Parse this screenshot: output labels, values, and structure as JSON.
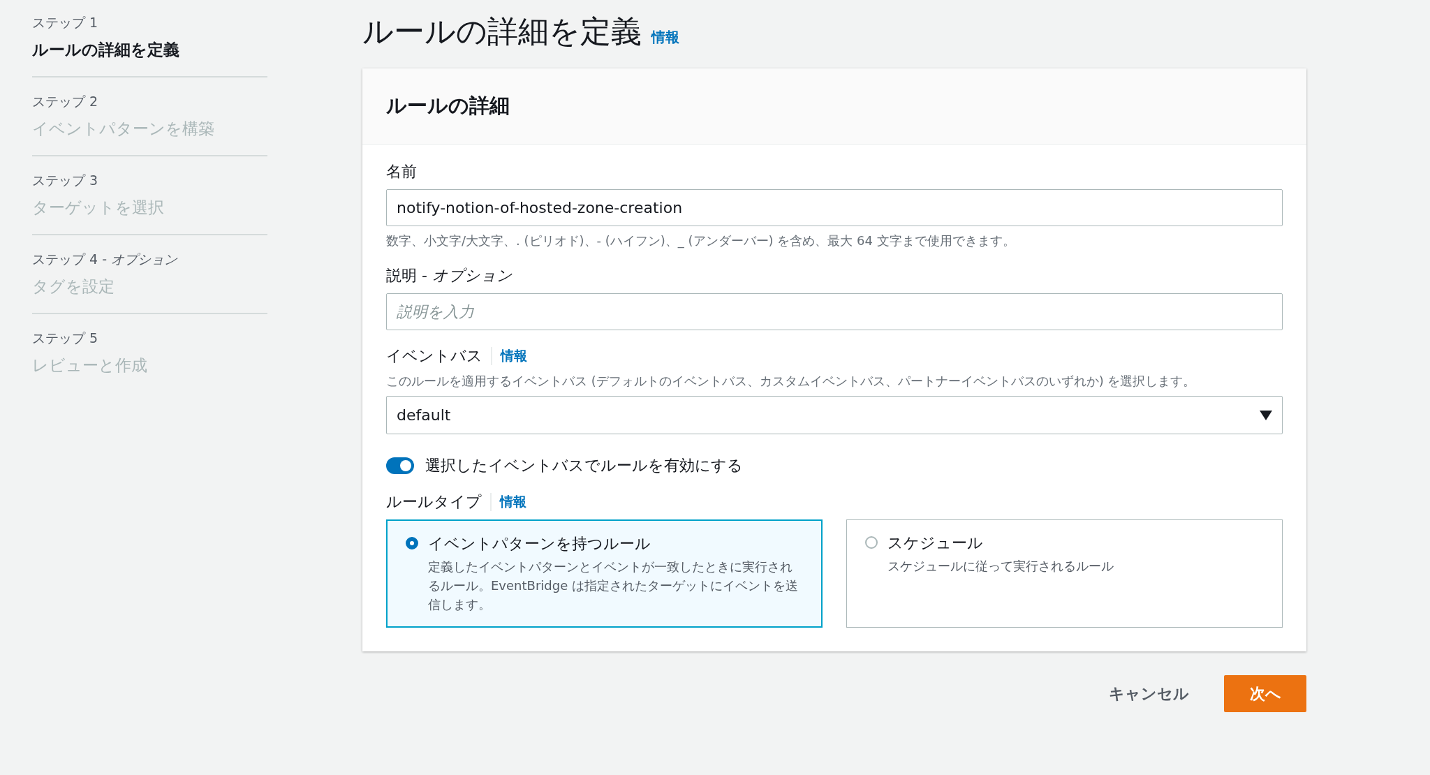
{
  "steps": [
    {
      "label": "ステップ 1",
      "title": "ルールの詳細を定義",
      "selected": true
    },
    {
      "label": "ステップ 2",
      "title": "イベントパターンを構築",
      "selected": false
    },
    {
      "label": "ステップ 3",
      "title": "ターゲットを選択",
      "selected": false
    },
    {
      "label": "ステップ 4 - *オプション*",
      "title": "タグを設定",
      "selected": false
    },
    {
      "label": "ステップ 5",
      "title": "レビューと作成",
      "selected": false
    }
  ],
  "page": {
    "title": "ルールの詳細を定義",
    "info": "情報"
  },
  "panel": {
    "title": "ルールの詳細",
    "name": {
      "label": "名前",
      "value": "notify-notion-of-hosted-zone-creation",
      "hint": "数字、小文字/大文字、. (ピリオド)、- (ハイフン)、_ (アンダーバー) を含め、最大 64 文字まで使用できます。"
    },
    "description": {
      "label": "説明 - *オプション*",
      "placeholder": "説明を入力"
    },
    "event_bus": {
      "label": "イベントバス",
      "info": "情報",
      "hint": "このルールを適用するイベントバス (デフォルトのイベントバス、カスタムイベントバス、パートナーイベントバスのいずれか) を選択します。",
      "value": "default"
    },
    "toggle": {
      "label": "選択したイベントバスでルールを有効にする",
      "on": true
    },
    "rule_type": {
      "label": "ルールタイプ",
      "info": "情報",
      "options": [
        {
          "title": "イベントパターンを持つルール",
          "description": "定義したイベントパターンとイベントが一致したときに実行されるルール。EventBridge は指定されたターゲットにイベントを送信します。",
          "selected": true
        },
        {
          "title": "スケジュール",
          "description": "スケジュールに従って実行されるルール",
          "selected": false
        }
      ]
    }
  },
  "buttons": {
    "cancel": "キャンセル",
    "next": "次へ"
  }
}
